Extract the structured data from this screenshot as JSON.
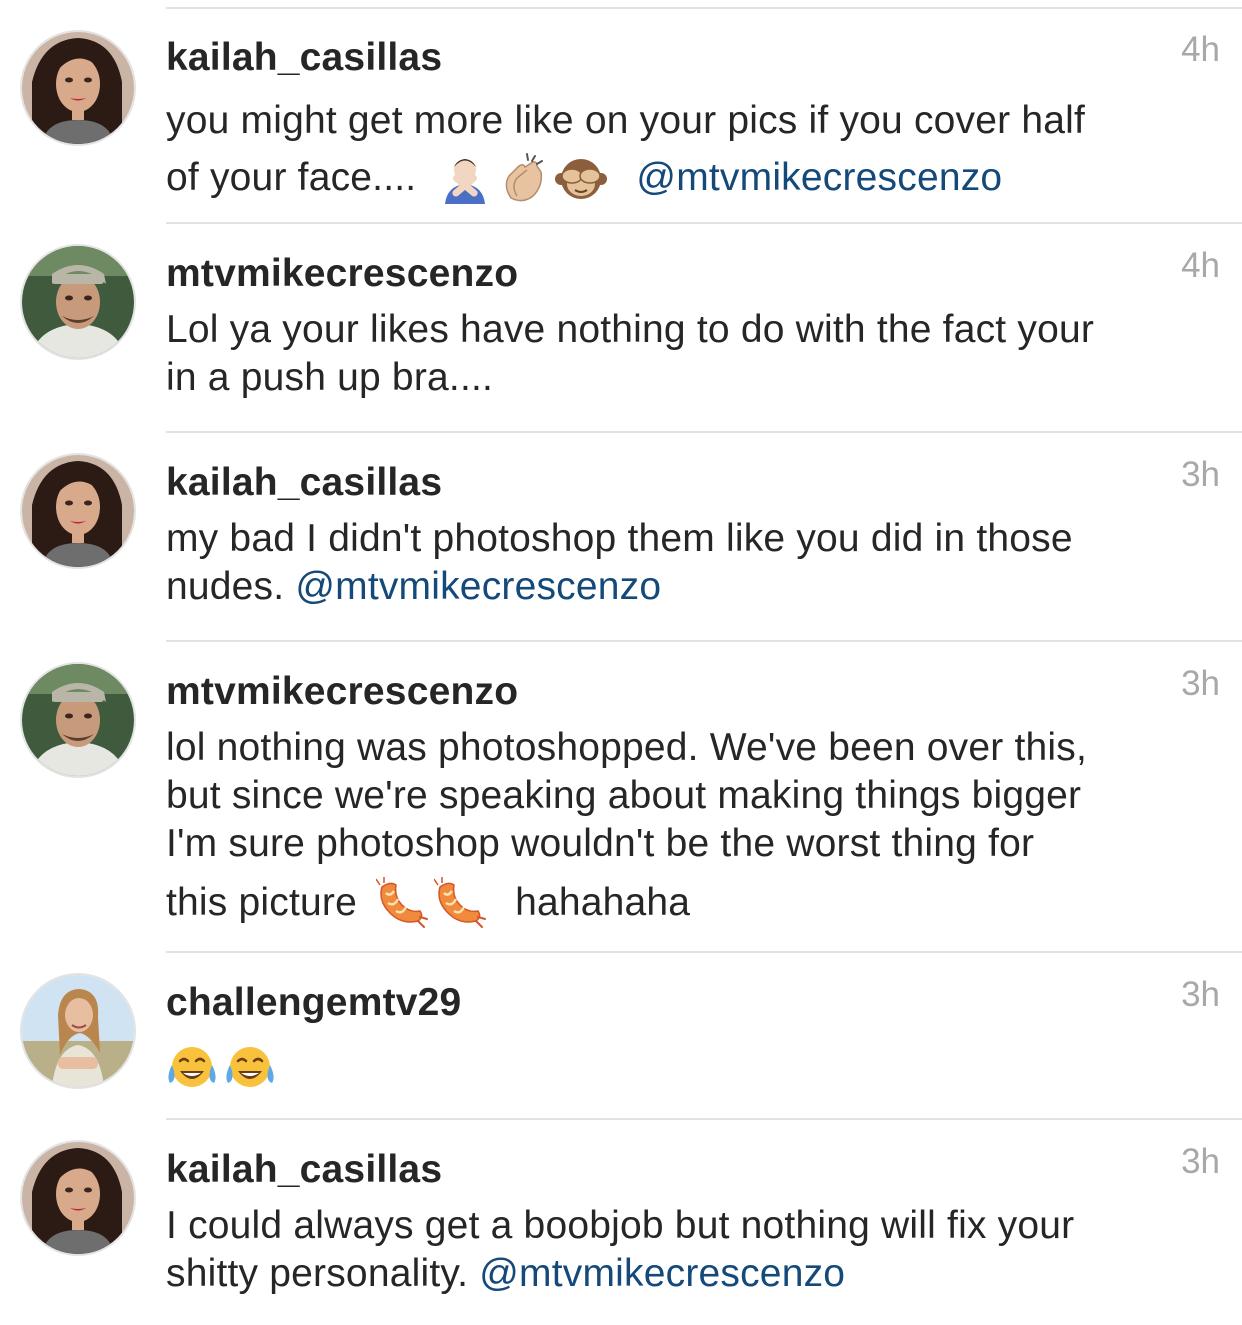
{
  "comments": [
    {
      "username": "kailah_casillas",
      "time": "4h",
      "lines": [
        {
          "text": "you might get more like on your pics if you cover half",
          "emojis": [],
          "mention": "",
          "after": ""
        },
        {
          "text": "of your face....",
          "emojis": [
            "person-gesturing-no-icon",
            "clapping-hands-icon",
            "see-no-evil-monkey-icon"
          ],
          "mention": "@mtvmikecrescenzo",
          "after": ""
        }
      ]
    },
    {
      "username": "mtvmikecrescenzo",
      "time": "4h",
      "lines": [
        {
          "text": "Lol ya your likes have nothing to do with the fact your",
          "emojis": [],
          "mention": "",
          "after": ""
        },
        {
          "text": "in a push up bra....",
          "emojis": [],
          "mention": "",
          "after": ""
        }
      ]
    },
    {
      "username": "kailah_casillas",
      "time": "3h",
      "lines": [
        {
          "text": "my bad I didn't photoshop them like you did in those",
          "emojis": [],
          "mention": "",
          "after": ""
        },
        {
          "text": "nudes.",
          "emojis": [],
          "mention": "@mtvmikecrescenzo",
          "after": ""
        }
      ]
    },
    {
      "username": "mtvmikecrescenzo",
      "time": "3h",
      "lines": [
        {
          "text": "lol nothing was photoshopped. We've been over this,",
          "emojis": [],
          "mention": "",
          "after": ""
        },
        {
          "text": "but since we're speaking about making things bigger",
          "emojis": [],
          "mention": "",
          "after": ""
        },
        {
          "text": "I'm sure photoshop wouldn't be the worst thing for",
          "emojis": [],
          "mention": "",
          "after": ""
        },
        {
          "text": "this picture",
          "emojis": [
            "shrimp-icon",
            "shrimp-icon"
          ],
          "mention": "",
          "after": "hahahaha"
        }
      ]
    },
    {
      "username": "challengemtv29",
      "time": "3h",
      "lines": [
        {
          "text": "",
          "emojis": [
            "tears-of-joy-icon",
            "tears-of-joy-icon"
          ],
          "mention": "",
          "after": ""
        }
      ]
    },
    {
      "username": "kailah_casillas",
      "time": "3h",
      "lines": [
        {
          "text": "I could always get a boobjob but nothing will fix your",
          "emojis": [],
          "mention": "",
          "after": ""
        },
        {
          "text": "shitty personality.",
          "emojis": [],
          "mention": "@mtvmikecrescenzo",
          "after": ""
        }
      ]
    }
  ],
  "colors": {
    "username": "#262626",
    "body_text": "#262626",
    "mention": "#14497a",
    "timestamp": "#a8a8a8",
    "separator": "#e2e2e2"
  }
}
